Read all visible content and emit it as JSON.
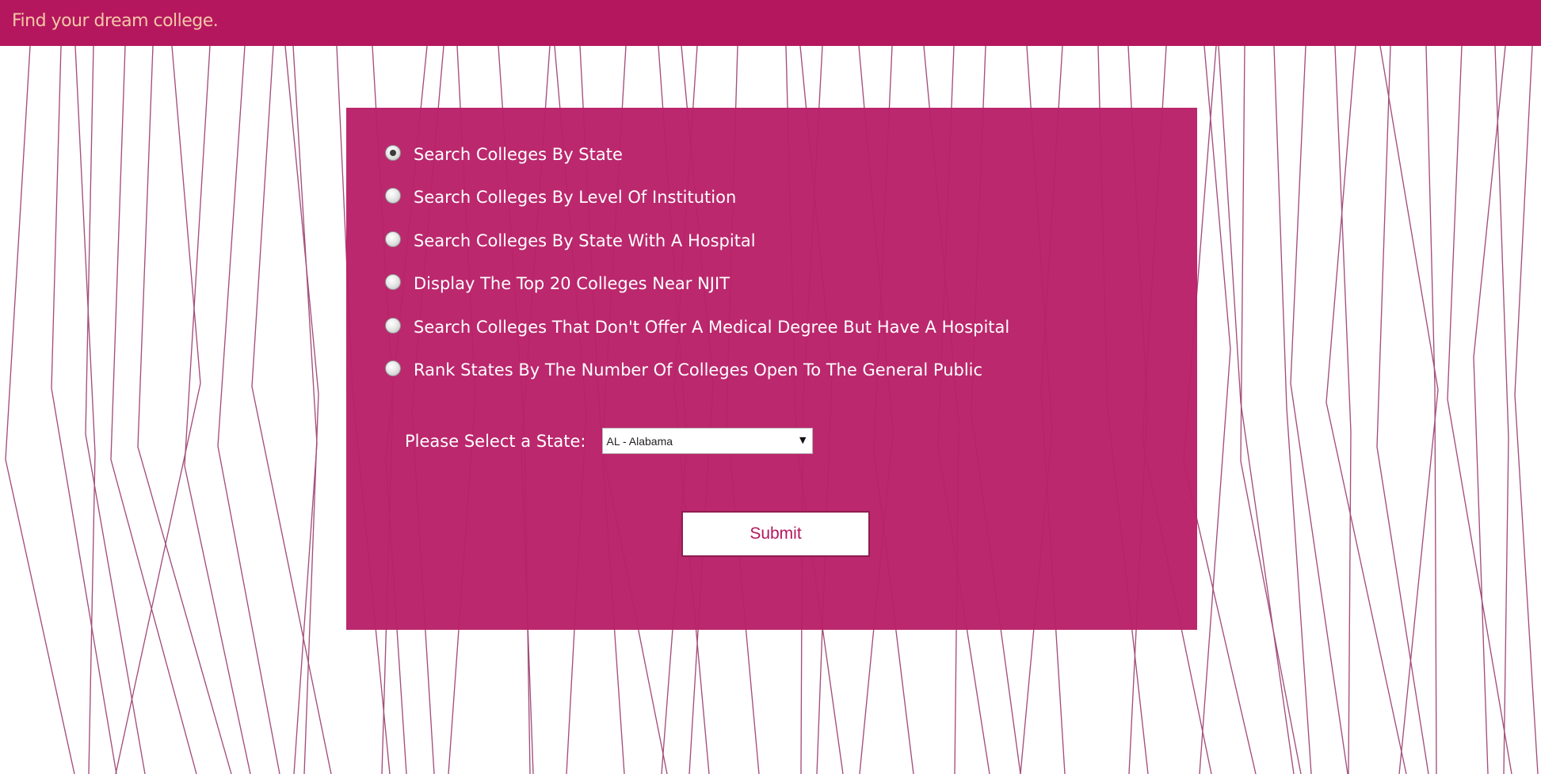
{
  "header": {
    "title": "Find your dream college."
  },
  "search_options": [
    {
      "label": "Search Colleges By State",
      "selected": true
    },
    {
      "label": "Search Colleges By Level Of Institution",
      "selected": false
    },
    {
      "label": "Search Colleges By State With A Hospital",
      "selected": false
    },
    {
      "label": "Display The Top 20 Colleges Near NJIT",
      "selected": false
    },
    {
      "label": "Search Colleges That Don't Offer A Medical Degree But Have A Hospital",
      "selected": false
    },
    {
      "label": "Rank States By The Number Of Colleges Open To The General Public",
      "selected": false
    }
  ],
  "state_select": {
    "label": "Please Select a State:",
    "value": "AL - Alabama"
  },
  "submit": {
    "label": "Submit"
  },
  "colors": {
    "header_background": "#b5175e",
    "panel_background": "#b92168",
    "brand_text": "#f5c7a6",
    "background_lines": "#8a1d57"
  }
}
